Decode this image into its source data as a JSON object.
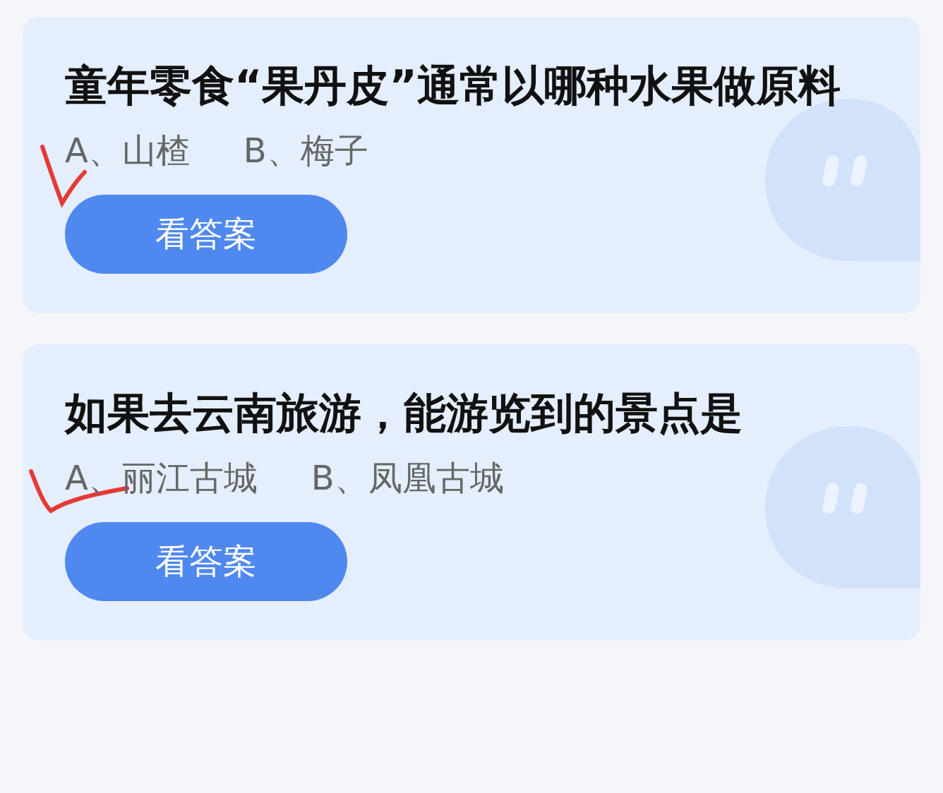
{
  "questions": [
    {
      "title": "童年零食“果丹皮”通常以哪种水果做原料",
      "options": [
        {
          "label": "A、山楂",
          "marked": true
        },
        {
          "label": "B、梅子",
          "marked": false
        }
      ],
      "button": "看答案"
    },
    {
      "title": "如果去云南旅游，能游览到的景点是",
      "options": [
        {
          "label": "A、丽江古城",
          "marked": true
        },
        {
          "label": "B、凤凰古城",
          "marked": false
        }
      ],
      "button": "看答案"
    }
  ]
}
